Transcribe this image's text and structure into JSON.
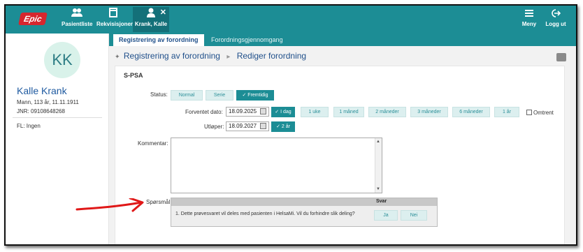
{
  "topbar": {
    "logo": "Epic",
    "nav": [
      {
        "label": "Pasientliste",
        "icon": "people-icon"
      },
      {
        "label": "Rekvisisjoner",
        "icon": "document-tray-icon"
      },
      {
        "label": "Krank, Kalle",
        "icon": "person-icon",
        "active": true
      }
    ],
    "close": "✕",
    "right": [
      {
        "label": "Meny",
        "icon": "hamburger-menu-icon"
      },
      {
        "label": "Logg ut",
        "icon": "logout-icon"
      }
    ]
  },
  "patient": {
    "initials": "KK",
    "name": "Kalle Krank",
    "details": "Mann, 113 år, 11.11.1911",
    "jnr_label": "JNR:",
    "jnr": "09108648268",
    "fl": "FL: Ingen"
  },
  "tabs": [
    {
      "label": "Registrering av forordning",
      "active": true
    },
    {
      "label": "Forordningsgjennomgang",
      "active": false
    }
  ],
  "breadcrumb": {
    "first": "Registrering av forordning",
    "second": "Rediger forordning"
  },
  "form": {
    "title": "S-PSA",
    "status_label": "Status:",
    "status_options": [
      {
        "label": "Normal",
        "selected": false
      },
      {
        "label": "Serie",
        "selected": false
      },
      {
        "label": "✓ Fremtidig",
        "selected": true
      }
    ],
    "forventet_label": "Forventet dato:",
    "forventet_value": "18.09.2025",
    "forventet_options": [
      {
        "label": "✓ I dag",
        "selected": true
      },
      {
        "label": "1 uke",
        "selected": false
      },
      {
        "label": "1 måned",
        "selected": false
      },
      {
        "label": "2 måneder",
        "selected": false
      },
      {
        "label": "3 måneder",
        "selected": false
      },
      {
        "label": "6 måneder",
        "selected": false
      },
      {
        "label": "1 år",
        "selected": false
      }
    ],
    "omtrent_label": "Omtrent",
    "utloper_label": "Utløper:",
    "utloper_value": "18.09.2027",
    "utloper_option": "✓ 2 år",
    "kommentar_label": "Kommentar:",
    "sporsmal_label": "Spørsmål:",
    "svar_header": "Svar",
    "question": "1. Dette prøvesvaret vil deles med pasienten i HelsaMi. Vil du forhindre slik deling?",
    "answer_yes": "Ja",
    "answer_no": "Nei"
  },
  "colors": {
    "teal": "#1c8d95",
    "red_arrow": "#e01818",
    "link_blue": "#1f4f8a"
  }
}
